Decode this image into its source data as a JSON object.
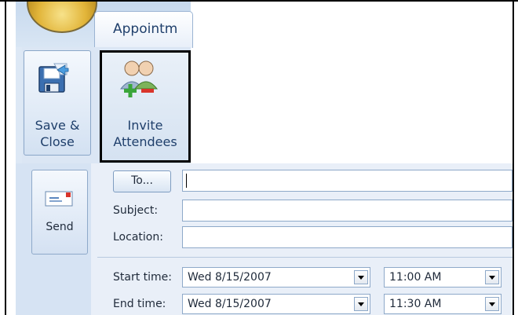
{
  "ribbon": {
    "tab_label": "Appointm",
    "save_close_line1": "Save &",
    "save_close_line2": "Close",
    "invite_line1": "Invite",
    "invite_line2": "Attendees"
  },
  "send": {
    "label": "Send"
  },
  "form": {
    "to_button": "To...",
    "to_value": "",
    "subject_label": "Subject:",
    "subject_value": "",
    "location_label": "Location:",
    "location_value": "",
    "start_label": "Start time:",
    "start_date": "Wed 8/15/2007",
    "start_time": "11:00 AM",
    "end_label": "End time:",
    "end_date": "Wed 8/15/2007",
    "end_time": "11:30 AM"
  },
  "icons": [
    "office-orb-icon",
    "save-floppy-icon",
    "invite-attendees-icon",
    "send-envelope-icon",
    "chevron-down-icon"
  ]
}
